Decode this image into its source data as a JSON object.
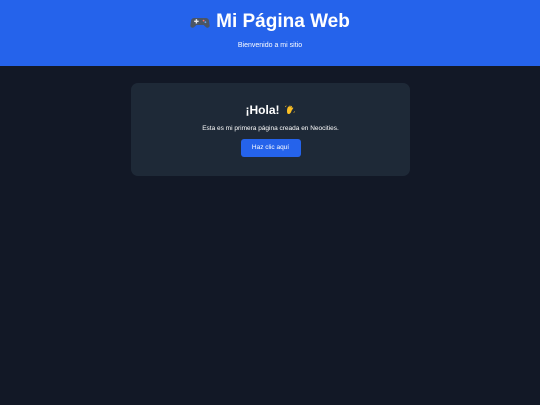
{
  "header": {
    "icon": "gamepad-icon",
    "title": "Mi Página Web",
    "subtitle": "Bienvenido a mi sitio"
  },
  "card": {
    "heading": "¡Hola!",
    "heading_icon": "waving-hand-icon",
    "text": "Esta es mi primera página creada en Neocities.",
    "button_label": "Haz clic aquí"
  },
  "colors": {
    "header_bg": "#2563eb",
    "page_bg": "#121826",
    "card_bg": "#1e2937",
    "button_bg": "#2563eb"
  }
}
